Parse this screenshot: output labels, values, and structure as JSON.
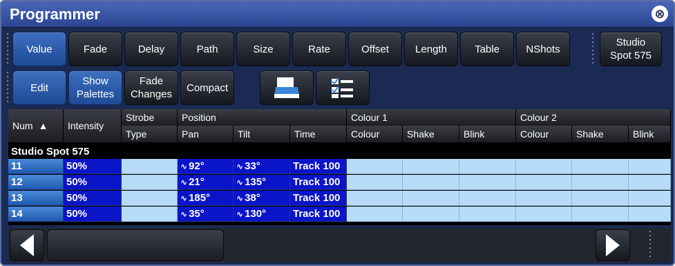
{
  "window": {
    "title": "Programmer"
  },
  "toolbar_row1": [
    {
      "label": "Value",
      "active": true
    },
    {
      "label": "Fade",
      "active": false
    },
    {
      "label": "Delay",
      "active": false
    },
    {
      "label": "Path",
      "active": false
    },
    {
      "label": "Size",
      "active": false
    },
    {
      "label": "Rate",
      "active": false
    },
    {
      "label": "Offset",
      "active": false
    },
    {
      "label": "Length",
      "active": false
    },
    {
      "label": "Table",
      "active": false
    },
    {
      "label": "NShots",
      "active": false
    }
  ],
  "fixture_button": {
    "line1": "Studio",
    "line2": "Spot 575"
  },
  "toolbar_row2": {
    "edit": "Edit",
    "show_palettes_line1": "Show",
    "show_palettes_line2": "Palettes",
    "fade_changes_line1": "Fade",
    "fade_changes_line2": "Changes",
    "compact": "Compact"
  },
  "table": {
    "headers_top": {
      "num": "Num",
      "intensity": "Intensity",
      "strobe": "Strobe",
      "position": "Position",
      "colour1": "Colour 1",
      "colour2": "Colour 2"
    },
    "headers_sub": {
      "type": "Type",
      "pan": "Pan",
      "tilt": "Tilt",
      "time": "Time",
      "c1_colour": "Colour",
      "c1_shake": "Shake",
      "c1_blink": "Blink",
      "c2_colour": "Colour",
      "c2_shake": "Shake",
      "c2_blink": "Blink"
    },
    "sort_indicator": "▲",
    "group": "Studio Spot 575",
    "rows": [
      {
        "num": "11",
        "intensity": "50%",
        "pan": "92°",
        "tilt": "33°",
        "time": "Track 100"
      },
      {
        "num": "12",
        "intensity": "50%",
        "pan": "21°",
        "tilt": "135°",
        "time": "Track 100"
      },
      {
        "num": "13",
        "intensity": "50%",
        "pan": "185°",
        "tilt": "38°",
        "time": "Track 100"
      },
      {
        "num": "14",
        "intensity": "50%",
        "pan": "35°",
        "tilt": "130°",
        "time": "Track 100"
      }
    ]
  },
  "icons": {
    "close": "close-circle-icon",
    "print": "printer-icon",
    "checklist": "checklist-icon",
    "path": "path-curve-icon"
  }
}
